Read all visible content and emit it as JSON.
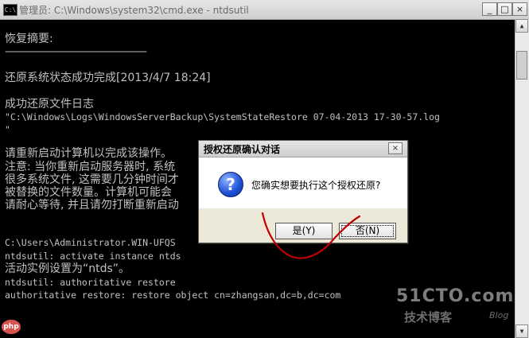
{
  "window": {
    "title": "管理员: C:\\Windows\\system32\\cmd.exe - ntdsutil",
    "icon_text": "C:\\",
    "minimize": "_",
    "maximize": "□",
    "close": "×"
  },
  "console": {
    "lines": [
      "恢复摘要:",
      "————————————————",
      "还原系统状态成功完成[2013/4/7 18:24]",
      "成功还原文件日志",
      " \"C:\\Windows\\Logs\\WindowsServerBackup\\SystemStateRestore 07-04-2013 17-30-57.log",
      "\"",
      "请重新启动计算机以完成该操作。",
      "注意: 当你重新启动服务器时, 系统",
      "很多系统文件, 这需要几分钟时间才",
      "被替换的文件数量。计算机可能会",
      "请耐心等待, 并且请勿打断重新启动",
      "C:\\Users\\Administrator.WIN-UFQS",
      "ntdsutil: activate instance ntds",
      "活动实例设置为“ntds”。",
      "ntdsutil: authoritative restore",
      "authoritative restore: restore object cn=zhangsan,dc=b,dc=com"
    ]
  },
  "dialog": {
    "title": "授权还原确认对话",
    "close": "×",
    "icon": "question-icon",
    "message": "您确实想要执行这个授权还原?",
    "yes_label": "是(Y)",
    "no_label": "否(N)"
  },
  "watermark": {
    "site": "51CTO.com",
    "blog": "技术博客",
    "blog_en": "Blog",
    "php": "php"
  },
  "colors": {
    "console_bg": "#000000",
    "console_text": "#c0c0c0",
    "annotation": "#c00000"
  }
}
